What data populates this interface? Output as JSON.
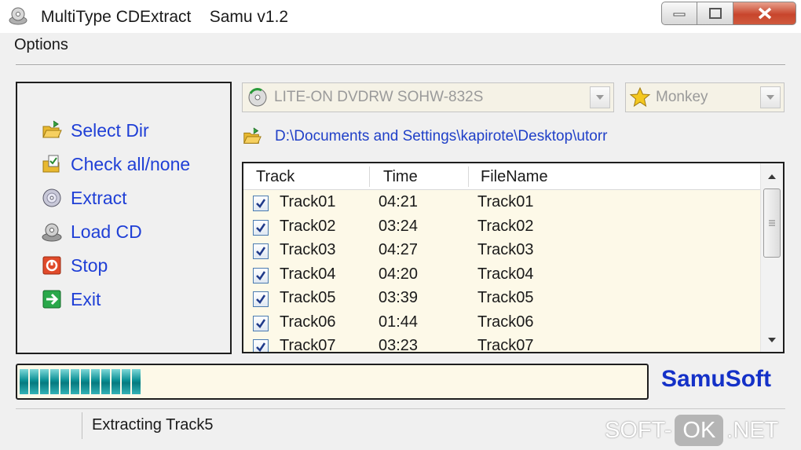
{
  "window": {
    "title": "MultiType CDExtract    Samu v1.2",
    "app_icon": "cd-drive-icon"
  },
  "menu": {
    "options_label": "Options"
  },
  "actions": [
    {
      "label": "Select Dir",
      "icon": "folder-open-icon"
    },
    {
      "label": "Check all/none",
      "icon": "checklist-icon"
    },
    {
      "label": "Extract",
      "icon": "disc-icon"
    },
    {
      "label": "Load CD",
      "icon": "load-cd-icon"
    },
    {
      "label": "Stop",
      "icon": "stop-icon"
    },
    {
      "label": "Exit",
      "icon": "exit-arrow-icon"
    }
  ],
  "drive": {
    "selected": "LITE-ON DVDRW SOHW-832S",
    "icon": "cd-refresh-icon"
  },
  "encoder": {
    "selected": "Monkey",
    "icon": "star-icon"
  },
  "output_path": "D:\\Documents and Settings\\kapirote\\Desktop\\utorr",
  "track_list": {
    "columns": [
      "Track",
      "Time",
      "FileName"
    ],
    "rows": [
      {
        "checked": true,
        "track": "Track01",
        "time": "04:21",
        "filename": "Track01"
      },
      {
        "checked": true,
        "track": "Track02",
        "time": "03:24",
        "filename": "Track02"
      },
      {
        "checked": true,
        "track": "Track03",
        "time": "04:27",
        "filename": "Track03"
      },
      {
        "checked": true,
        "track": "Track04",
        "time": "04:20",
        "filename": "Track04"
      },
      {
        "checked": true,
        "track": "Track05",
        "time": "03:39",
        "filename": "Track05"
      },
      {
        "checked": true,
        "track": "Track06",
        "time": "01:44",
        "filename": "Track06"
      },
      {
        "checked": true,
        "track": "Track07",
        "time": "03:23",
        "filename": "Track07"
      }
    ]
  },
  "progress": {
    "fraction": 0.2,
    "color": "#0a8f94"
  },
  "brand": "SamuSoft",
  "status": {
    "text": "Extracting Track5"
  },
  "watermark": {
    "left": "SOFT-",
    "mid": "OK",
    "right": ".NET"
  },
  "colors": {
    "action_text": "#1f3fd6",
    "brand": "#1431c8",
    "list_bg": "#fdf9e8"
  }
}
